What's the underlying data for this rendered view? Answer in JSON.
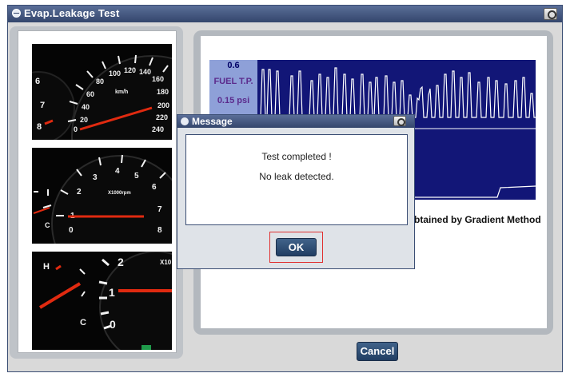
{
  "window": {
    "title": "Evap.Leakage Test"
  },
  "gauges": {
    "speedometer": {
      "ticks": [
        "60",
        "80",
        "100",
        "120",
        "140",
        "160",
        "180",
        "200",
        "220",
        "240",
        "40",
        "20",
        "0"
      ],
      "unit": "km/h",
      "left_ticks": [
        "6",
        "7",
        "8"
      ]
    },
    "tachometer": {
      "ticks": [
        "1",
        "2",
        "3",
        "4",
        "5",
        "6",
        "7",
        "8",
        "0"
      ],
      "unit": "X1000rpm",
      "left_marks": [
        "C"
      ]
    },
    "temp_gauge": {
      "marks": [
        "H",
        "C",
        "2",
        "1",
        "0"
      ],
      "unit": "X10"
    }
  },
  "graph": {
    "label_top": "0.6",
    "label_name": "FUEL T.P.",
    "label_bottom": "0.15 psi",
    "line_color": "#ffffff",
    "background": "#121677"
  },
  "result": {
    "text": "btained by Gradient Method"
  },
  "buttons": {
    "cancel": "Cancel"
  },
  "dialog": {
    "title": "Message",
    "line1": "Test completed !",
    "line2": "No leak detected.",
    "ok": "OK"
  }
}
